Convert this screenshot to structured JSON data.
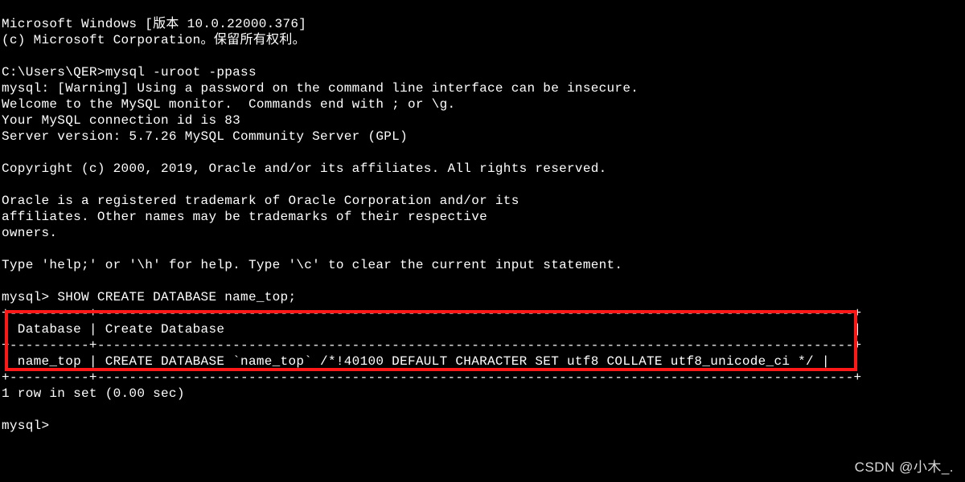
{
  "lines": {
    "l1": "Microsoft Windows [版本 10.0.22000.376]",
    "l2": "(c) Microsoft Corporation。保留所有权利。",
    "l3": "",
    "l4_prompt": "C:\\Users\\QER>",
    "l4_cmd": "mysql -uroot -ppass",
    "l5": "mysql: [Warning] Using a password on the command line interface can be insecure.",
    "l6": "Welcome to the MySQL monitor.  Commands end with ; or \\g.",
    "l7": "Your MySQL connection id is 83",
    "l8": "Server version: 5.7.26 MySQL Community Server (GPL)",
    "l9": "",
    "l10": "Copyright (c) 2000, 2019, Oracle and/or its affiliates. All rights reserved.",
    "l11": "",
    "l12": "Oracle is a registered trademark of Oracle Corporation and/or its",
    "l13": "affiliates. Other names may be trademarks of their respective",
    "l14": "owners.",
    "l15": "",
    "l16": "Type 'help;' or '\\h' for help. Type '\\c' to clear the current input statement.",
    "l17": "",
    "l18_prompt": "mysql> ",
    "l18_cmd": "SHOW CREATE DATABASE name_top;",
    "t_sep": "+----------+-----------------------------------------------------------------------------------------------+",
    "t_hdr": "| Database | Create Database                                                                               |",
    "t_row": "| name_top | CREATE DATABASE `name_top` /*!40100 DEFAULT CHARACTER SET utf8 COLLATE utf8_unicode_ci */ |",
    "l23": "1 row in set (0.00 sec)",
    "l24": "",
    "l25_prompt": "mysql>"
  },
  "watermark": "CSDN @小木_."
}
